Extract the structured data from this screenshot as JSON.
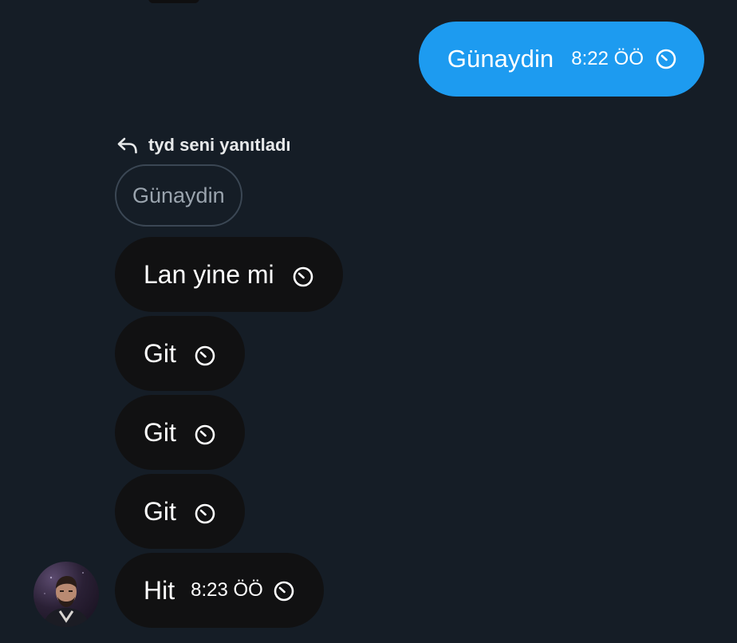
{
  "outgoing": {
    "text": "Günaydin",
    "time": "8:22 ÖÖ",
    "status_icon": "clock-icon",
    "color": "#1d9bf0"
  },
  "reply": {
    "header": "tyd seni yanıtladı",
    "header_icon": "reply-arrow-icon",
    "quoted_text": "Günaydin"
  },
  "incoming": [
    {
      "text": "Lan yine mi",
      "time": "",
      "status_icon": "clock-icon"
    },
    {
      "text": "Git",
      "time": "",
      "status_icon": "clock-icon"
    },
    {
      "text": "Git",
      "time": "",
      "status_icon": "clock-icon"
    },
    {
      "text": "Git",
      "time": "",
      "status_icon": "clock-icon"
    },
    {
      "text": "Hit",
      "time": "8:23 ÖÖ",
      "status_icon": "clock-icon"
    }
  ],
  "sender_avatar": "avatar-icon",
  "colors": {
    "background": "#151d26",
    "incoming_bubble": "#111112",
    "outgoing_bubble": "#1d9bf0"
  }
}
